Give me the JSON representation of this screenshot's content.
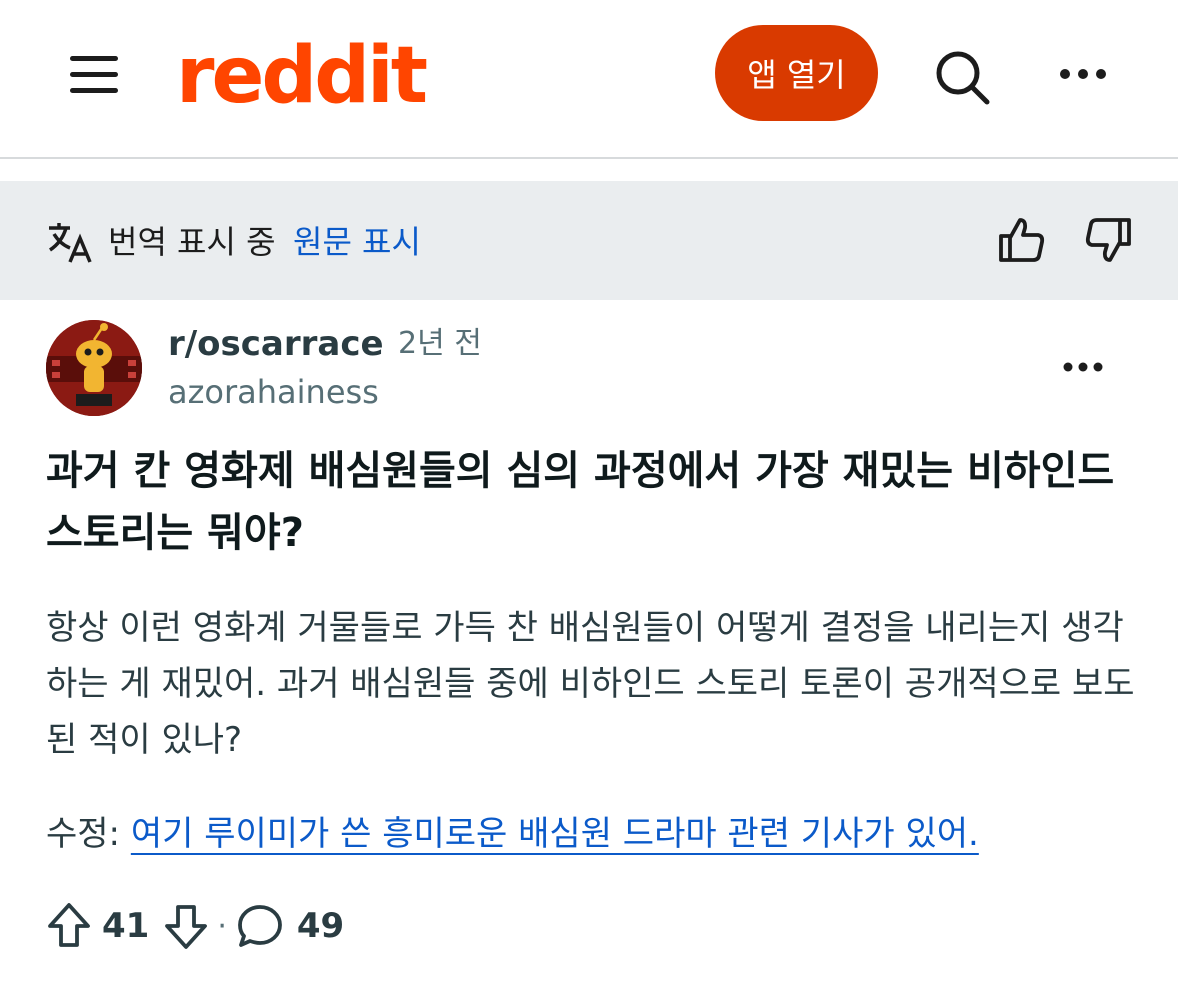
{
  "header": {
    "logo_text": "reddit",
    "open_app_label": "앱 열기",
    "icons": [
      "menu-icon",
      "search-icon",
      "more-icon"
    ],
    "brand_color": "#ff4500",
    "button_color": "#d93a00"
  },
  "translation": {
    "status": "번역 표시 중",
    "show_original": "원문 표시",
    "icons": [
      "translate-icon",
      "thumbs-up-icon",
      "thumbs-down-icon"
    ],
    "link_color": "#0b5ac9"
  },
  "post": {
    "subreddit": "r/oscarrace",
    "time": "2년 전",
    "author": "azorahainess",
    "title": "과거 칸 영화제 배심원들의 심의 과정에서 가장 재밌는 비하인드 스토리는 뭐야?",
    "body": "항상 이런 영화계 거물들로 가득 찬 배심원들이 어떻게 결정을 내리는지 생각하는 게 재밌어. 과거 배심원들 중에 비하인드 스토리 토론이 공개적으로 보도된 적이 있나?",
    "edit_prefix": "수정: ",
    "edit_link": "여기 루이미가 쓴 흥미로운 배심원 드라마 관련 기사가 있어.",
    "upvotes": "41",
    "separator": "·",
    "comments": "49"
  }
}
